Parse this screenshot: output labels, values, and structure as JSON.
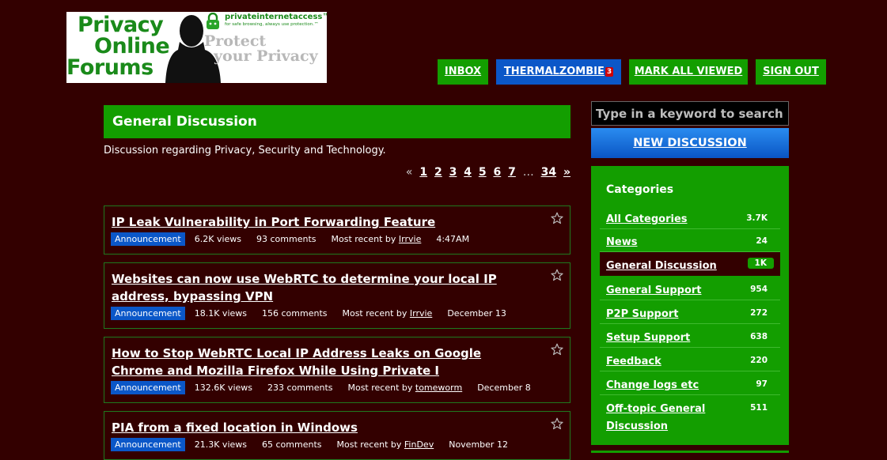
{
  "logo": {
    "title_line1": "Privacy",
    "title_line2": "Online",
    "title_line3": "Forums",
    "brand": "privateinternetaccess™",
    "brand_tag": "for safe browsing, always use protection.™",
    "tagline_line1": "Protect",
    "tagline_line2": "your Privacy"
  },
  "nav": {
    "inbox": "INBOX",
    "user": "THERMALZOMBIE",
    "user_badge": "3",
    "mark_all": "MARK ALL VIEWED",
    "sign_out": "SIGN OUT"
  },
  "category": {
    "title": "General Discussion",
    "description": "Discussion regarding Privacy, Security and Technology."
  },
  "pager": {
    "prev": "«",
    "pages": [
      "1",
      "2",
      "3",
      "4",
      "5",
      "6",
      "7"
    ],
    "ellipsis": "…",
    "last": "34",
    "next": "»"
  },
  "discussions": [
    {
      "title": "IP Leak Vulnerability in Port Forwarding Feature",
      "tag": "Announcement",
      "views": "6.2K views",
      "comments": "93 comments",
      "recent_label": "Most recent by",
      "recent_user": "Irrvie",
      "time": "4:47AM"
    },
    {
      "title": "Websites can now use WebRTC to determine your local IP address, bypassing VPN",
      "tag": "Announcement",
      "views": "18.1K views",
      "comments": "156 comments",
      "recent_label": "Most recent by",
      "recent_user": "Irrvie",
      "time": "December 13"
    },
    {
      "title": "How to Stop WebRTC Local IP Address Leaks on Google Chrome and Mozilla Firefox While Using Private I",
      "tag": "Announcement",
      "views": "132.6K views",
      "comments": "233 comments",
      "recent_label": "Most recent by",
      "recent_user": "tomeworm",
      "time": "December 8"
    },
    {
      "title": "PIA from a fixed location in Windows",
      "tag": "Announcement",
      "views": "21.3K views",
      "comments": "65 comments",
      "recent_label": "Most recent by",
      "recent_user": "FinDev",
      "time": "November 12"
    }
  ],
  "sidebar": {
    "search_placeholder": "Type in a keyword to search",
    "new_discussion": "NEW DISCUSSION",
    "categories_heading": "Categories",
    "categories": [
      {
        "name": "All Categories",
        "count": "3.7K"
      },
      {
        "name": "News",
        "count": "24"
      },
      {
        "name": "General Discussion",
        "count": "1K"
      },
      {
        "name": "General Support",
        "count": "954"
      },
      {
        "name": "P2P Support",
        "count": "272"
      },
      {
        "name": "Setup Support",
        "count": "638"
      },
      {
        "name": "Feedback",
        "count": "220"
      },
      {
        "name": "Change logs etc",
        "count": "97"
      },
      {
        "name": "Off-topic General Discussion",
        "count": "511"
      }
    ]
  },
  "colors": {
    "background": "#330000",
    "green": "#139e00",
    "blue": "#0b57c8"
  }
}
